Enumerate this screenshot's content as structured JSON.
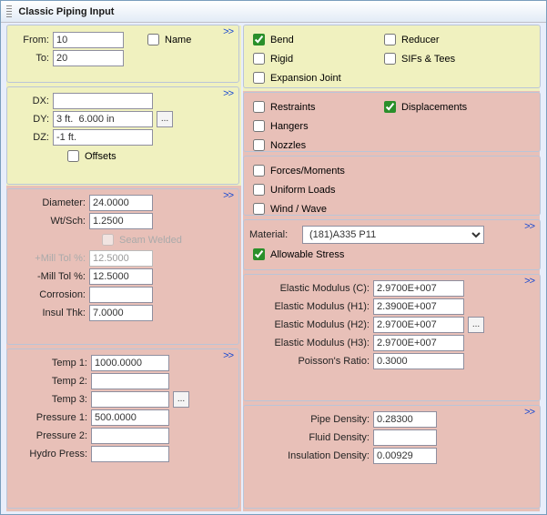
{
  "title": "Classic Piping Input",
  "more_glyph": ">>",
  "nodes": {
    "from_label": "From:",
    "to_label": "To:",
    "from": "10",
    "to": "20",
    "name_label": "Name"
  },
  "deltas": {
    "dx_label": "DX:",
    "dy_label": "DY:",
    "dz_label": "DZ:",
    "dx": "",
    "dy": "3 ft.  6.000 in",
    "dz": "-1 ft.",
    "offsets_label": "Offsets",
    "browse": "..."
  },
  "pipe": {
    "diameter_label": "Diameter:",
    "diameter": "24.0000",
    "wtsch_label": "Wt/Sch:",
    "wtsch": "1.2500",
    "seam_label": "Seam Welded",
    "ptol_label": "+Mill Tol %:",
    "ptol": "12.5000",
    "ntol_label": "-Mill Tol %:",
    "ntol": "12.5000",
    "corr_label": "Corrosion:",
    "corr": "",
    "insul_label": "Insul Thk:",
    "insul": "7.0000"
  },
  "loads": {
    "t1_label": "Temp 1:",
    "t1": "1000.0000",
    "t2_label": "Temp 2:",
    "t2": "",
    "t3_label": "Temp 3:",
    "t3": "",
    "p1_label": "Pressure 1:",
    "p1": "500.0000",
    "p2_label": "Pressure 2:",
    "p2": "",
    "hp_label": "Hydro Press:",
    "hp": "",
    "browse": "..."
  },
  "elem": {
    "bend": "Bend",
    "rigid": "Rigid",
    "expjoint": "Expansion Joint",
    "reducer": "Reducer",
    "sifs": "SIFs & Tees"
  },
  "bc": {
    "restraints": "Restraints",
    "hangers": "Hangers",
    "nozzles": "Nozzles",
    "displacements": "Displacements"
  },
  "loads2": {
    "forces": "Forces/Moments",
    "uniform": "Uniform Loads",
    "wind": "Wind / Wave"
  },
  "material": {
    "label": "Material:",
    "value": "(181)A335 P11",
    "allow_label": "Allowable Stress"
  },
  "modulus": {
    "ec_label": "Elastic Modulus (C):",
    "ec": "2.9700E+007",
    "eh1_label": "Elastic Modulus (H1):",
    "eh1": "2.3900E+007",
    "eh2_label": "Elastic Modulus (H2):",
    "eh2": "2.9700E+007",
    "eh3_label": "Elastic Modulus (H3):",
    "eh3": "2.9700E+007",
    "pr_label": "Poisson's Ratio:",
    "pr": "0.3000",
    "browse": "..."
  },
  "density": {
    "pipe_label": "Pipe Density:",
    "pipe": "0.28300",
    "fluid_label": "Fluid Density:",
    "fluid": "",
    "ins_label": "Insulation Density:",
    "ins": "0.00929"
  }
}
